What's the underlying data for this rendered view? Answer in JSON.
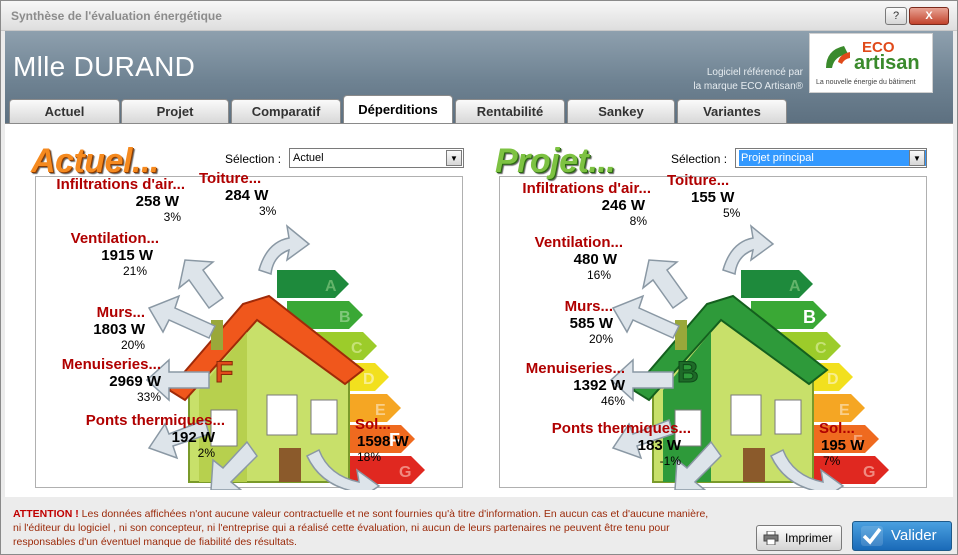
{
  "window": {
    "title": "Synthèse de l'évaluation énergétique",
    "help_glyph": "?",
    "close_glyph": "X"
  },
  "header": {
    "client_name": "Mlle DURAND",
    "software_line1": "Logiciel référencé par",
    "software_line2": "la marque ECO Artisan®",
    "logo_eco": "ECO",
    "logo_artisan": "artisan",
    "logo_tagline": "La nouvelle énergie du bâtiment"
  },
  "tabs": [
    {
      "label": "Actuel",
      "active": false
    },
    {
      "label": "Projet",
      "active": false
    },
    {
      "label": "Comparatif",
      "active": false
    },
    {
      "label": "Déperditions",
      "active": true
    },
    {
      "label": "Rentabilité",
      "active": false
    },
    {
      "label": "Sankey",
      "active": false
    },
    {
      "label": "Variantes",
      "active": false
    }
  ],
  "panels": {
    "left": {
      "title": "Actuel...",
      "selection_label": "Sélection :",
      "selection_value": "Actuel",
      "energy_class": "F",
      "labels": {
        "infiltrations": {
          "name": "Infiltrations d'air...",
          "watts": "258 W",
          "pct": "3%"
        },
        "toiture": {
          "name": "Toiture...",
          "watts": "284 W",
          "pct": "3%"
        },
        "ventilation": {
          "name": "Ventilation...",
          "watts": "1915 W",
          "pct": "21%"
        },
        "murs": {
          "name": "Murs...",
          "watts": "1803 W",
          "pct": "20%"
        },
        "menuiseries": {
          "name": "Menuiseries...",
          "watts": "2969 W",
          "pct": "33%"
        },
        "ponts": {
          "name": "Ponts thermiques...",
          "watts": "192 W",
          "pct": "2%"
        },
        "sol": {
          "name": "Sol...",
          "watts": "1598 W",
          "pct": "18%"
        }
      }
    },
    "right": {
      "title": "Projet...",
      "selection_label": "Sélection :",
      "selection_value": "Projet principal",
      "energy_class": "B",
      "labels": {
        "infiltrations": {
          "name": "Infiltrations d'air...",
          "watts": "246 W",
          "pct": "8%"
        },
        "toiture": {
          "name": "Toiture...",
          "watts": "155 W",
          "pct": "5%"
        },
        "ventilation": {
          "name": "Ventilation...",
          "watts": "480 W",
          "pct": "16%"
        },
        "murs": {
          "name": "Murs...",
          "watts": "585 W",
          "pct": "20%"
        },
        "menuiseries": {
          "name": "Menuiseries...",
          "watts": "1392 W",
          "pct": "46%"
        },
        "ponts": {
          "name": "Ponts thermiques...",
          "watts": "183 W",
          "pct": "-1%"
        },
        "sol": {
          "name": "Sol...",
          "watts": "195 W",
          "pct": "7%"
        }
      }
    }
  },
  "energy_scale": [
    "A",
    "B",
    "C",
    "D",
    "E",
    "F",
    "G"
  ],
  "colors": {
    "class_A": "#1e8a3c",
    "class_B": "#3aa835",
    "class_C": "#9ccc2a",
    "class_D": "#f2e01e",
    "class_E": "#f5a623",
    "class_F": "#ef6a1f",
    "class_G": "#e02820",
    "label_red": "#b00000"
  },
  "footer": {
    "warning_prefix": "ATTENTION !",
    "warning_line1": " Les données affichées n'ont aucune valeur contractuelle et ne sont fournies qu'à titre d'information. En aucun cas et d'aucune manière,",
    "warning_line2": "ni l'éditeur du logiciel , ni son concepteur, ni l'entreprise qui a réalisé cette évaluation, ni aucun de leurs partenaires ne peuvent être tenu pour",
    "warning_line3": "responsables d'un éventuel manque de fiabilité des résultats.",
    "print_label": "Imprimer",
    "validate_label": "Valider"
  }
}
